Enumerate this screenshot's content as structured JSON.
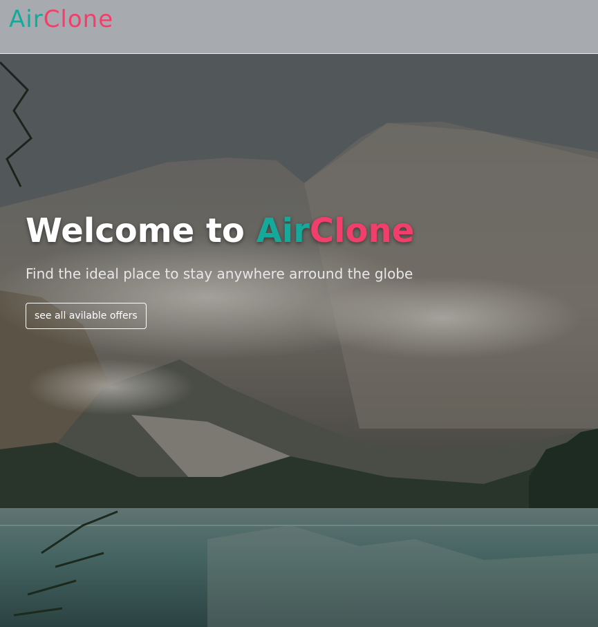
{
  "navbar": {
    "brand_part1": "Air",
    "brand_part2": "Clone"
  },
  "hero": {
    "headline_prefix": "Welcome to ",
    "headline_brand_part1": "Air",
    "headline_brand_part2": "Clone",
    "subtitle": "Find the ideal place to stay anywhere arround the globe",
    "cta_label": "see all avilable offers"
  },
  "colors": {
    "brand_teal": "#15a99c",
    "brand_pink": "#f23e6b",
    "text_white": "#ffffff"
  }
}
